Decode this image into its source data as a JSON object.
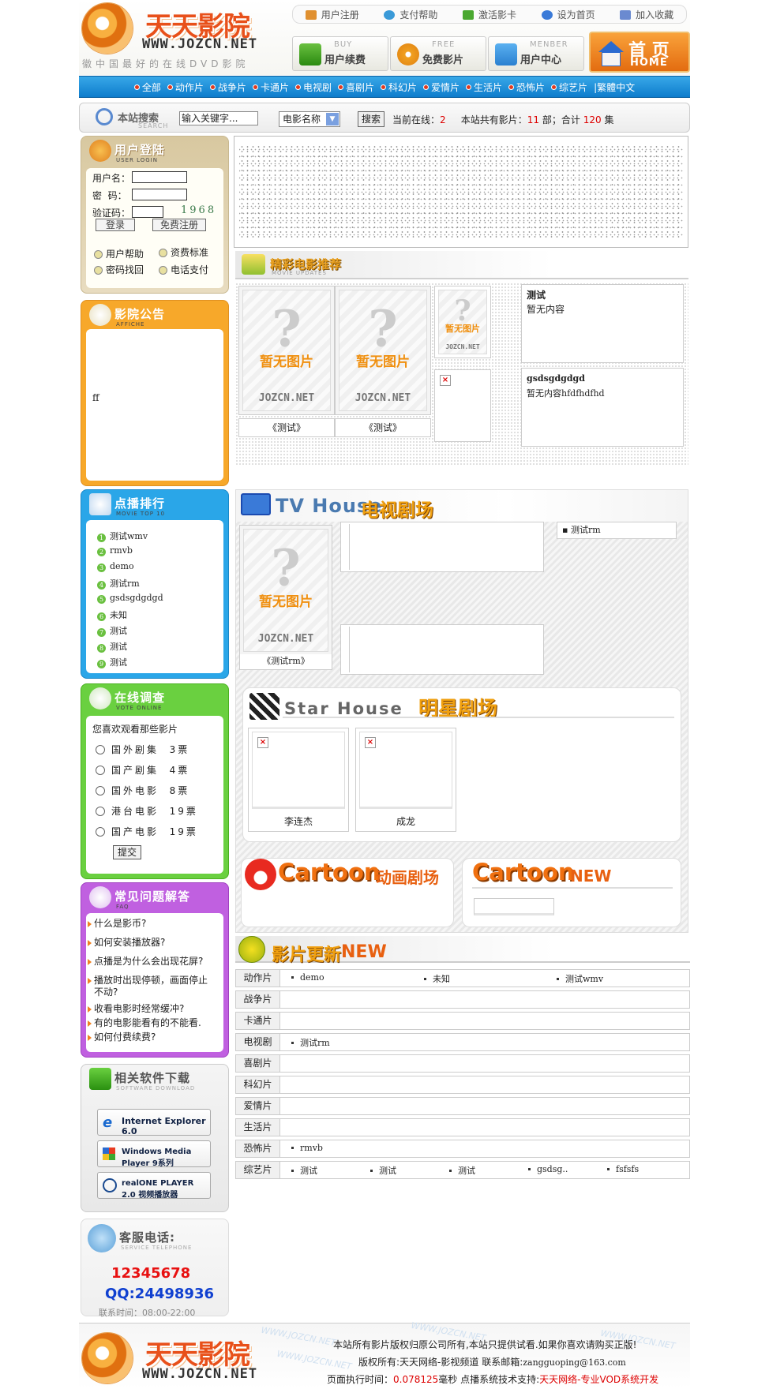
{
  "header": {
    "logo_cn": "天天影院",
    "logo_en": "WWW.JOZCN.NET",
    "slogan": "徽中国最好的在线DVD影院",
    "top_links": [
      "用户注册",
      "支付帮助",
      "激活影卡",
      "设为首页",
      "加入收藏"
    ],
    "nav_buttons": [
      {
        "en": "BUY",
        "cn": "用户续费"
      },
      {
        "en": "FREE",
        "cn": "免费影片"
      },
      {
        "en": "MENBER",
        "cn": "用户中心"
      }
    ],
    "home": {
      "cn": "首 页",
      "en": "HOME"
    }
  },
  "menu": [
    "全部",
    "动作片",
    "战争片",
    "卡通片",
    "电视剧",
    "喜剧片",
    "科幻片",
    "爱情片",
    "生活片",
    "恐怖片",
    "综艺片"
  ],
  "menu_extra": "|繁體中文",
  "search": {
    "title": "本站搜索",
    "title_en": "SEARCH",
    "keyword": "输入关键字...",
    "select": "电影名称",
    "button": "搜索",
    "online_label": "当前在线：",
    "online_value": "2",
    "total_label": "本站共有影片：",
    "total_movies": "11",
    "total_mid": "部；合计",
    "total_eps": "120",
    "total_unit": "集"
  },
  "login": {
    "title": "用户登陆",
    "title_en": "USER LOGIN",
    "user_label": "用户名：",
    "pass_label": "密  码：",
    "code_label": "验证码：",
    "code_value": "1968",
    "login_btn": "登录",
    "reg_btn": "免费注册",
    "links": [
      "用户帮助",
      "资费标准",
      "密码找回",
      "电话支付"
    ]
  },
  "notice": {
    "title": "影院公告",
    "title_en": "AFFICHE",
    "content": "ff"
  },
  "rank": {
    "title": "点播排行",
    "title_en": "MOVIE TOP 10",
    "items": [
      "测试wmv",
      "rmvb",
      "demo",
      "测试rm",
      "gsdsgdgdgd",
      "未知",
      "测试",
      "测试",
      "测试"
    ]
  },
  "vote": {
    "title": "在线调查",
    "title_en": "VOTE ONLINE",
    "question": "您喜欢观看那些影片",
    "options": [
      "国外剧集  3票",
      "国产剧集  4票",
      "国外电影  8票",
      "港台电影  19票",
      "国产电影  19票"
    ],
    "submit": "提交"
  },
  "faq": {
    "title": "常见问题解答",
    "title_en": "FAQ",
    "items": [
      "什么是影币?",
      "如何安装播放器?",
      "点播是为什么会出现花屏?",
      "播放时出现停顿，画面停止不动?",
      "收看电影时经常缓冲?",
      "有的电影能看有的不能看.",
      "如何付费续费?"
    ]
  },
  "software": {
    "title": "相关软件下载",
    "title_en": "SOFTWARE DOWNLOAD",
    "items": [
      "Internet Explorer 6.0",
      "Windows Media Player 9系列",
      "realONE PLAYER 2.0 视频播放器"
    ]
  },
  "service": {
    "title": "客服电话:",
    "title_en": "SERVICE TELEPHONE",
    "phone": "12345678",
    "qq": "QQ:24498936",
    "hours": "联系时间：08:00-22:00"
  },
  "recommend": {
    "title": "精彩电影推荐",
    "title_en": "MOVIE UPDATES",
    "noimg": "暂无图片",
    "site": "JOZCN.NET",
    "posters": [
      "《测试》",
      "《测试》"
    ],
    "texts": [
      {
        "title": "测试",
        "desc": "暂无内容"
      },
      {
        "title": "gsdsgdgdgd",
        "desc": "暂无内容hfdfhdfhd"
      }
    ]
  },
  "tv": {
    "en": "TV House",
    "cn": "电视剧场",
    "poster_caption": "《测试rm》",
    "list": [
      "测试rm"
    ]
  },
  "star": {
    "en": "Star House",
    "cn": "明星剧场",
    "people": [
      "李连杰",
      "成龙"
    ]
  },
  "cartoon": {
    "left_en": "Cartoon",
    "left_cn": "动画剧场",
    "right_en": "Cartoon",
    "right_cn": "NEW"
  },
  "updates": {
    "title": "影片更新",
    "title_en": "NEW",
    "rows": [
      {
        "cat": "动作片",
        "items": [
          "demo",
          "未知",
          "测试wmv"
        ]
      },
      {
        "cat": "战争片",
        "items": []
      },
      {
        "cat": "卡通片",
        "items": []
      },
      {
        "cat": "电视剧",
        "items": [
          "测试rm"
        ]
      },
      {
        "cat": "喜剧片",
        "items": []
      },
      {
        "cat": "科幻片",
        "items": []
      },
      {
        "cat": "爱情片",
        "items": []
      },
      {
        "cat": "生活片",
        "items": []
      },
      {
        "cat": "恐怖片",
        "items": [
          "rmvb"
        ]
      },
      {
        "cat": "综艺片",
        "items": [
          "测试",
          "测试",
          "测试",
          "gsdsg..",
          "fsfsfs"
        ]
      }
    ]
  },
  "footer": {
    "line1": "本站所有影片版权归原公司所有,本站只提供试看.如果你喜欢请购买正版!",
    "line2_a": "版权所有:天天网络-影视频道 联系邮箱:",
    "email": "zangguoping@163.com",
    "line3_a": "页面执行时间：",
    "exec_time": "0.078125",
    "line3_b": "毫秒 点播系统技术支持:",
    "support": "天天网络-专业VOD系统开发",
    "watermark": "WWW.JOZCN.NET"
  }
}
